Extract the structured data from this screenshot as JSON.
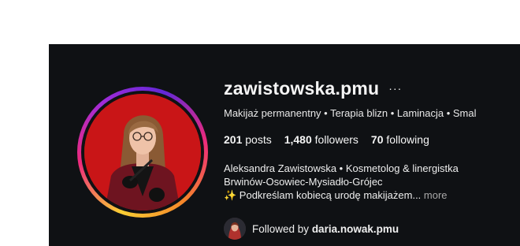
{
  "profile": {
    "username": "zawistowska.pmu",
    "more_icon": "···",
    "category": "Makijaż permanentny • Terapia blizn • Laminacja • Smal",
    "stats": {
      "posts_count": "201",
      "posts_label": "posts",
      "followers_count": "1,480",
      "followers_label": "followers",
      "following_count": "70",
      "following_label": "following"
    },
    "bio": {
      "line1": "Aleksandra Zawistowska • Kosmetolog & linergistka",
      "line2": "Brwinów-Osowiec-Mysiadło-Grójec",
      "line3_emoji": "✨",
      "line3": " Podkreślam kobiecą urodę makijażem...",
      "more": "more"
    },
    "followed_by": {
      "prefix": "Followed by ",
      "user": "daria.nowak.pmu"
    }
  },
  "colors": {
    "panel_bg": "#0f1114",
    "avatar_bg": "#c91517",
    "muted_text": "#a8a8a8"
  }
}
